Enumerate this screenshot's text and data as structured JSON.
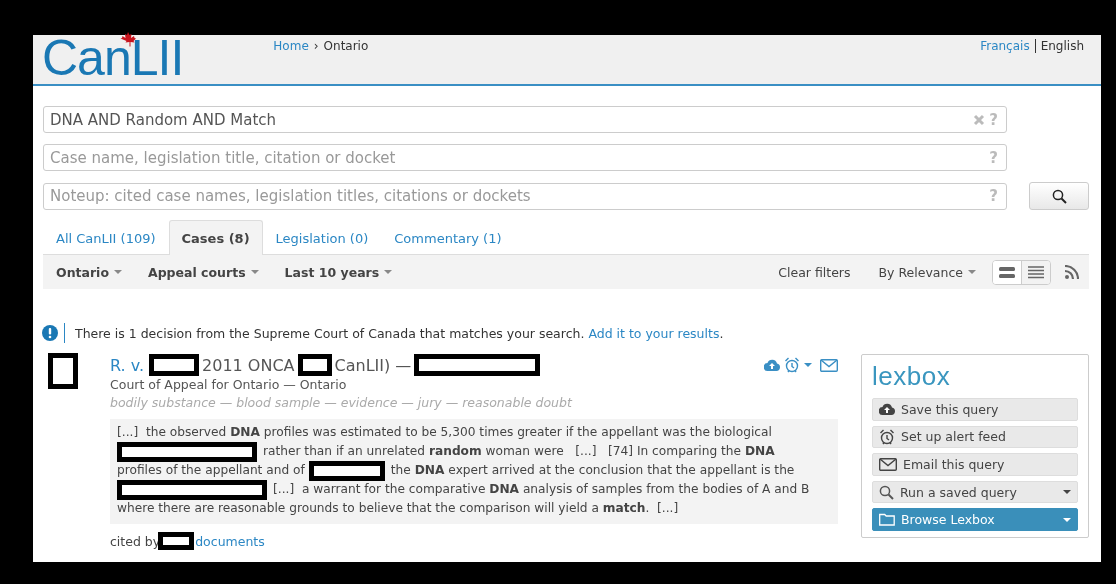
{
  "header": {
    "logo": "CanLII",
    "breadcrumb": [
      {
        "kind": "link",
        "label": "Home"
      },
      {
        "kind": "separator",
        "label": "›"
      },
      {
        "kind": "current",
        "label": "Ontario"
      }
    ],
    "languages": [
      {
        "label": "Français",
        "selected": false
      },
      {
        "label": "English",
        "selected": true
      }
    ]
  },
  "search": {
    "fields": [
      {
        "value": "DNA AND Random AND Match",
        "clearable": true,
        "help": "?"
      },
      {
        "placeholder": "Case name, legislation title, citation or docket",
        "clearable": false,
        "help": "?"
      },
      {
        "placeholder": "Noteup: cited case names, legislation titles, citations or dockets",
        "clearable": false,
        "help": "?"
      }
    ]
  },
  "tabs": [
    {
      "label": "All CanLII (109)",
      "selected": false
    },
    {
      "label": "Cases (8)",
      "selected": true
    },
    {
      "label": "Legislation (0)",
      "selected": false
    },
    {
      "label": "Commentary (1)",
      "selected": false
    }
  ],
  "filters": [
    {
      "label": "Ontario"
    },
    {
      "label": "Appeal courts"
    },
    {
      "label": "Last 10 years"
    }
  ],
  "clear_filters": "Clear filters",
  "sort": "By Relevance",
  "view_modes": [
    {
      "kind": "expanded",
      "selected": true
    },
    {
      "kind": "compact",
      "selected": false
    }
  ],
  "notice": {
    "text": "There is 1 decision from the Supreme Court of Canada that matches your search. ",
    "link": "Add it to your results",
    "end": "."
  },
  "results": [
    {
      "title": [
        {
          "kind": "link",
          "text": "R. v."
        },
        {
          "kind": "redaction"
        },
        {
          "kind": "text",
          "text": "2011 ONCA"
        },
        {
          "kind": "redaction"
        },
        {
          "kind": "text",
          "text": "CanLII) —"
        },
        {
          "kind": "redaction"
        }
      ],
      "court": "Court of Appeal for Ontario — Ontario",
      "keywords": "bodily substance — blood sample — evidence — jury — reasonable doubt",
      "snippet": [
        [
          {
            "kind": "text",
            "text": "[...]  the observed **DNA** profiles was estimated to be 5,300 times greater if the appellant was the biological"
          }
        ],
        [
          {
            "kind": "redaction"
          },
          {
            "kind": "text",
            "text": "rather than if an unrelated **random** woman were   [...]   [74] In comparing the **DNA**"
          }
        ],
        [
          {
            "kind": "text",
            "text": "profiles of the appellant and of"
          },
          {
            "kind": "redaction"
          },
          {
            "kind": "text",
            "text": "the **DNA** expert arrived at the conclusion that the appellant is the"
          }
        ],
        [
          {
            "kind": "redaction"
          },
          {
            "kind": "text",
            "text": "[...]  a warrant for the comparative **DNA** analysis of samples from the bodies of A and B"
          }
        ],
        [
          {
            "kind": "text",
            "text": "where there are reasonable grounds to believe that the comparison will yield a **match**.  [...]"
          }
        ]
      ],
      "cited_by": [
        {
          "kind": "text",
          "text": "cited by"
        },
        {
          "kind": "redaction"
        },
        {
          "kind": "link",
          "text": "documents"
        }
      ]
    }
  ],
  "lexbox": {
    "logo": "lexbox",
    "actions": [
      {
        "label": "Save this query",
        "kind": "plain"
      },
      {
        "label": "Set up alert feed",
        "kind": "plain"
      },
      {
        "label": "Email this query",
        "kind": "plain"
      },
      {
        "label": "Run a saved query",
        "kind": "dropdown"
      },
      {
        "label": "Browse Lexbox",
        "kind": "primary"
      }
    ]
  }
}
